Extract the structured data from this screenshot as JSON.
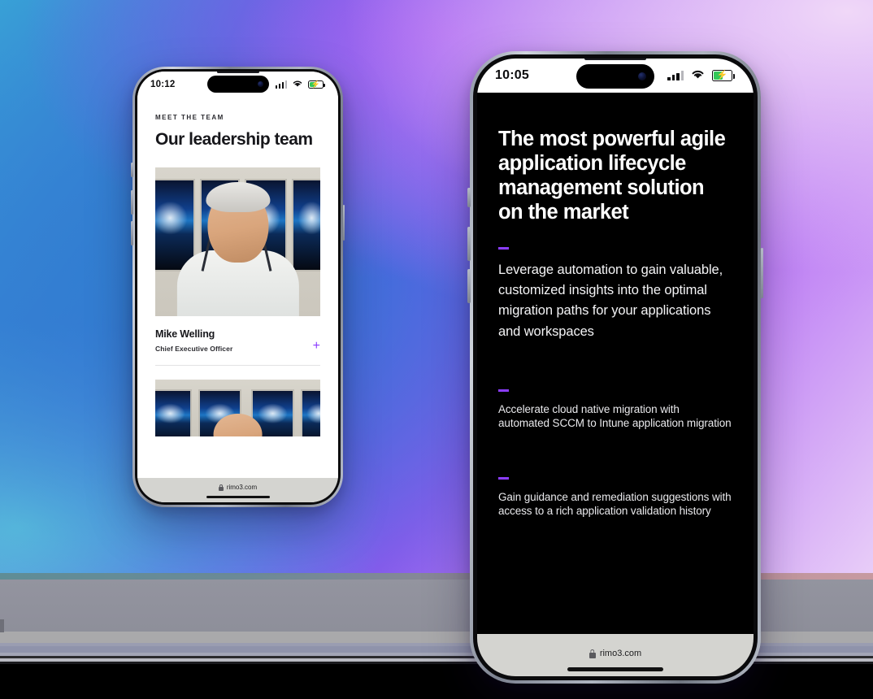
{
  "scene": {
    "background": {
      "kind": "gradient-wallpaper",
      "colors": [
        "#3aa7d8",
        "#3f7ad8",
        "#6a4bf0",
        "#9b52f2",
        "#c38af5",
        "#e8cdf8"
      ],
      "desk_colors": [
        "#93949f",
        "#a9a9ab",
        "#8f93ab",
        "#000000"
      ]
    },
    "accent_purple": "#8b3dff"
  },
  "left_phone": {
    "status_bar": {
      "time": "10:12",
      "signal_icon": "cellular-bars-icon",
      "wifi_icon": "wifi-icon",
      "battery_icon": "battery-charging-icon",
      "battery_bolt": "⚡"
    },
    "page": {
      "eyebrow": "MEET THE TEAM",
      "title": "Our leadership team",
      "photo_alt": "portrait-of-mike-welling",
      "member": {
        "name": "Mike Welling",
        "role": "Chief Executive Officer",
        "expand_icon": "plus-icon",
        "expand_glyph": "+"
      },
      "next_photo_alt": "portrait-of-next-team-member"
    },
    "url_bar": {
      "lock_icon": "lock-icon",
      "url": "rimo3.com"
    }
  },
  "right_phone": {
    "status_bar": {
      "time": "10:05",
      "signal_icon": "cellular-bars-icon",
      "wifi_icon": "wifi-icon",
      "battery_icon": "battery-charging-icon",
      "battery_bolt": "⚡"
    },
    "page": {
      "headline": "The most powerful agile application lifecycle management solution on the market",
      "features": [
        {
          "dash_icon": "dash-accent-icon",
          "text": "Leverage automation to gain valuable, customized insights into the optimal migration paths for your applications and workspaces",
          "emphasis": "lead"
        },
        {
          "dash_icon": "dash-accent-icon",
          "text": "Accelerate cloud native migration with automated SCCM to Intune application migration",
          "emphasis": "sub"
        },
        {
          "dash_icon": "dash-accent-icon",
          "text": "Gain guidance and remediation suggestions with access to a rich application validation history",
          "emphasis": "sub"
        }
      ]
    },
    "url_bar": {
      "lock_icon": "lock-icon",
      "url": "rimo3.com"
    }
  }
}
